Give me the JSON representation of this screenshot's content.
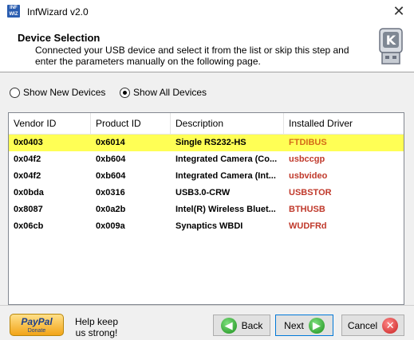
{
  "window": {
    "title": "InfWizard v2.0",
    "close_glyph": "✕",
    "app_icon_line1": "INF",
    "app_icon_line2": "WIZ"
  },
  "header": {
    "title": "Device Selection",
    "description": "Connected your USB device and select it from the list or skip this step and enter the parameters manually on the following page."
  },
  "filters": [
    {
      "label": "Show New Devices",
      "checked": false
    },
    {
      "label": "Show All Devices",
      "checked": true
    }
  ],
  "table": {
    "columns": [
      "Vendor ID",
      "Product ID",
      "Description",
      "Installed Driver"
    ],
    "rows": [
      {
        "vendor": "0x0403",
        "product": "0x6014",
        "description": "Single RS232-HS",
        "driver": "FTDIBUS",
        "highlighted": true
      },
      {
        "vendor": "0x04f2",
        "product": "0xb604",
        "description": "Integrated Camera (Co...",
        "driver": "usbccgp",
        "highlighted": false
      },
      {
        "vendor": "0x04f2",
        "product": "0xb604",
        "description": "Integrated Camera (Int...",
        "driver": "usbvideo",
        "highlighted": false
      },
      {
        "vendor": "0x0bda",
        "product": "0x0316",
        "description": "USB3.0-CRW",
        "driver": "USBSTOR",
        "highlighted": false
      },
      {
        "vendor": "0x8087",
        "product": "0x0a2b",
        "description": "Intel(R) Wireless Bluet...",
        "driver": "BTHUSB",
        "highlighted": false
      },
      {
        "vendor": "0x06cb",
        "product": "0x009a",
        "description": "Synaptics WBDI",
        "driver": "WUDFRd",
        "highlighted": false
      }
    ]
  },
  "footer": {
    "paypal_label": "PayPal",
    "paypal_sub": "Donate",
    "help_text": "Help keep us strong!",
    "back_label": "Back",
    "next_label": "Next",
    "cancel_label": "Cancel",
    "back_glyph": "◀",
    "next_glyph": "▶",
    "cancel_glyph": "✕"
  },
  "colors": {
    "highlight": "#ffff55",
    "driver_text": "#c0392b",
    "accent": "#0078d7"
  }
}
